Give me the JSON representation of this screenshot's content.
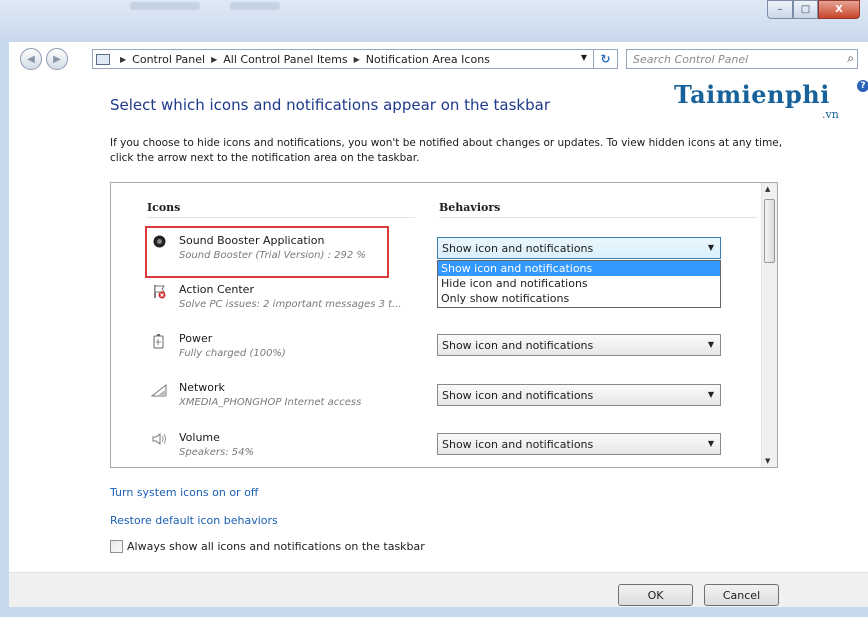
{
  "window": {
    "controls": {
      "minimize": "–",
      "maximize": "□",
      "close": "X"
    }
  },
  "navigation": {
    "back_icon": "back-arrow-icon",
    "forward_icon": "forward-arrow-icon",
    "breadcrumb": [
      "Control Panel",
      "All Control Panel Items",
      "Notification Area Icons"
    ],
    "search_placeholder": "Search Control Panel"
  },
  "watermark": {
    "brand": "Taimienphi",
    "suffix": ".vn"
  },
  "page": {
    "heading": "Select which icons and notifications appear on the taskbar",
    "description": "If you choose to hide icons and notifications, you won't be notified about changes or updates. To view hidden icons at any time, click the arrow next to the notification area on the taskbar."
  },
  "table": {
    "col_icons": "Icons",
    "col_behaviors": "Behaviors",
    "rows": [
      {
        "name": "Sound Booster Application",
        "detail": "Sound Booster (Trial Version) : 292 %",
        "behavior": "Show icon and notifications",
        "icon": "sound-booster-icon"
      },
      {
        "name": "Action Center",
        "detail": "Solve PC issues: 2 important messages  3 t...",
        "behavior": "",
        "icon": "action-center-flag-icon"
      },
      {
        "name": "Power",
        "detail": "Fully charged (100%)",
        "behavior": "Show icon and notifications",
        "icon": "power-battery-icon"
      },
      {
        "name": "Network",
        "detail": "XMEDIA_PHONGHOP Internet access",
        "behavior": "Show icon and notifications",
        "icon": "network-signal-icon"
      },
      {
        "name": "Volume",
        "detail": "Speakers: 54%",
        "behavior": "Show icon and notifications",
        "icon": "speaker-volume-icon"
      }
    ],
    "dropdown_options": [
      "Show icon and notifications",
      "Hide icon and notifications",
      "Only show notifications"
    ],
    "dropdown_highlighted": "Show icon and notifications"
  },
  "links": {
    "system_icons": "Turn system icons on or off",
    "restore": "Restore default icon behaviors"
  },
  "always_show": {
    "label": "Always show all icons and notifications on the taskbar",
    "checked": false
  },
  "buttons": {
    "ok": "OK",
    "cancel": "Cancel"
  }
}
